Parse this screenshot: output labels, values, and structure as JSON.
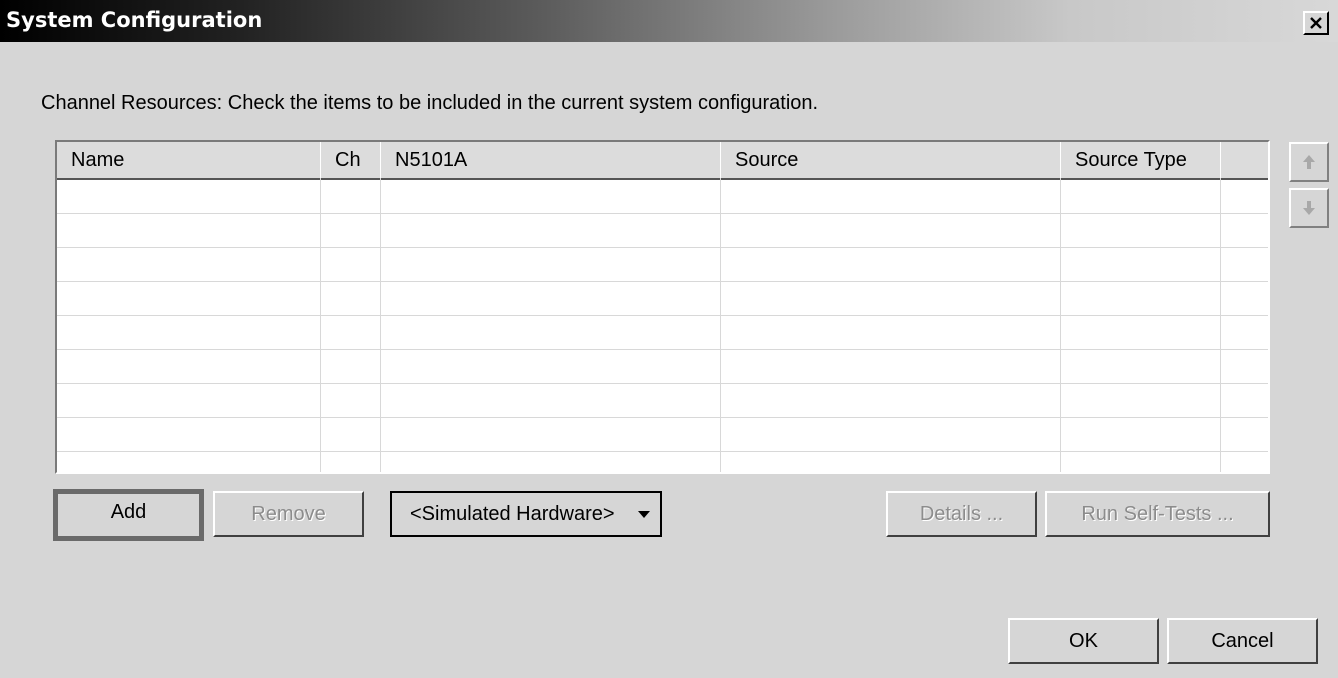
{
  "window": {
    "title": "System Configuration",
    "close_glyph": "✕"
  },
  "instructions": "Channel Resources: Check the items to be included in the current system configuration.",
  "table": {
    "columns": [
      "Name",
      "Ch",
      "N5101A",
      "Source",
      "Source Type",
      ""
    ],
    "row_count": 9,
    "rows": []
  },
  "buttons": {
    "add": "Add",
    "remove": "Remove",
    "hardware_select": "<Simulated Hardware>",
    "details": "Details ...",
    "run_self_tests": "Run Self-Tests ...",
    "ok": "OK",
    "cancel": "Cancel",
    "move_up_icon": "arrow-up-icon",
    "move_down_icon": "arrow-down-icon"
  }
}
